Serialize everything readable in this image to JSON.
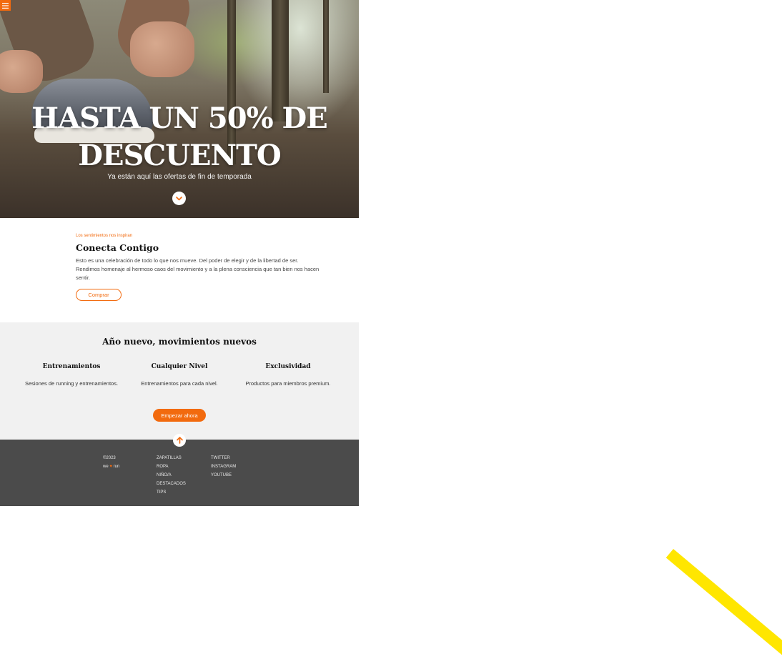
{
  "hero": {
    "title": "HASTA UN 50% DE DESCUENTO",
    "subtitle": "Ya están aquí las ofertas de fin de temporada",
    "scroll_icon": "chevron-down-icon",
    "menu_icon": "hamburger-icon"
  },
  "intro": {
    "eyebrow": "Los sentimientos nos inspiran",
    "title": "Conecta Contigo",
    "text": "Esto es una celebración de todo lo que nos mueve. Del poder de elegir y de la libertad de ser. Rendimos homenaje al hermoso caos del movimiento y a la plena consciencia que tan bien nos hacen sentir.",
    "button": "Comprar"
  },
  "features": {
    "title": "Año nuevo, movimientos nuevos",
    "items": [
      {
        "title": "Entrenamientos",
        "text": "Sesiones de running y entrenamientos."
      },
      {
        "title": "Cualquier Nivel",
        "text": "Entrenamientos para cada nivel."
      },
      {
        "title": "Exclusividad",
        "text": "Productos para miembros premium."
      }
    ],
    "button": "Empezar ahora",
    "up_icon": "arrow-up-icon"
  },
  "footer": {
    "copyright": "©2023",
    "brand_left": "we",
    "brand_right": "run",
    "brand_icon": "heart-icon",
    "links": [
      "ZAPATILLAS",
      "ROPA",
      "NIÑO/A",
      "DESTACADOS",
      "TIPS"
    ],
    "social": [
      "TWITTER",
      "INSTAGRAM",
      "YOUTUBE"
    ]
  },
  "colors": {
    "accent": "#f26a0e",
    "footer_bg": "#4b4b4b",
    "section_bg": "#f1f1f1",
    "stripe": "#ffe600"
  }
}
